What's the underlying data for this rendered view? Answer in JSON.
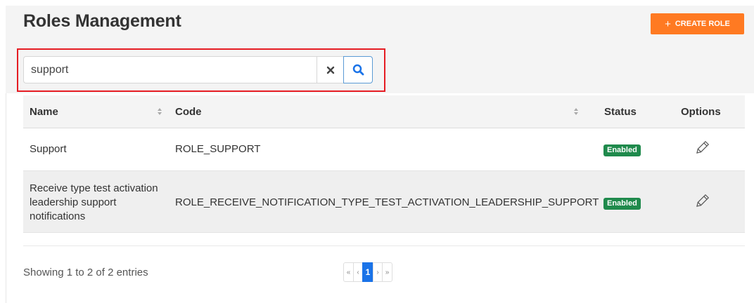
{
  "page": {
    "title": "Roles Management"
  },
  "toolbar": {
    "create_label": "CREATE ROLE",
    "create_icon": "plus-icon",
    "accent_color": "#ff7a22"
  },
  "search": {
    "value": "support",
    "placeholder": ""
  },
  "table": {
    "columns": [
      "Name",
      "Code",
      "Status",
      "Options"
    ],
    "rows": [
      {
        "name": [
          "Support"
        ],
        "code": "ROLE_SUPPORT",
        "status": "Enabled"
      },
      {
        "name": [
          "Receive type test activation",
          "leadership support",
          "notifications"
        ],
        "code": "ROLE_RECEIVE_NOTIFICATION_TYPE_TEST_ACTIVATION_LEADERSHIP_SUPPORT",
        "status": "Enabled"
      }
    ]
  },
  "footer": {
    "info": "Showing 1 to 2 of 2 entries"
  },
  "pagination": {
    "first": "«",
    "prev": "‹",
    "current": "1",
    "next": "›",
    "last": "»"
  },
  "colors": {
    "status_enabled": "#1f8a4c",
    "page_active": "#1a73e8",
    "search_outline": "#e51c23"
  }
}
